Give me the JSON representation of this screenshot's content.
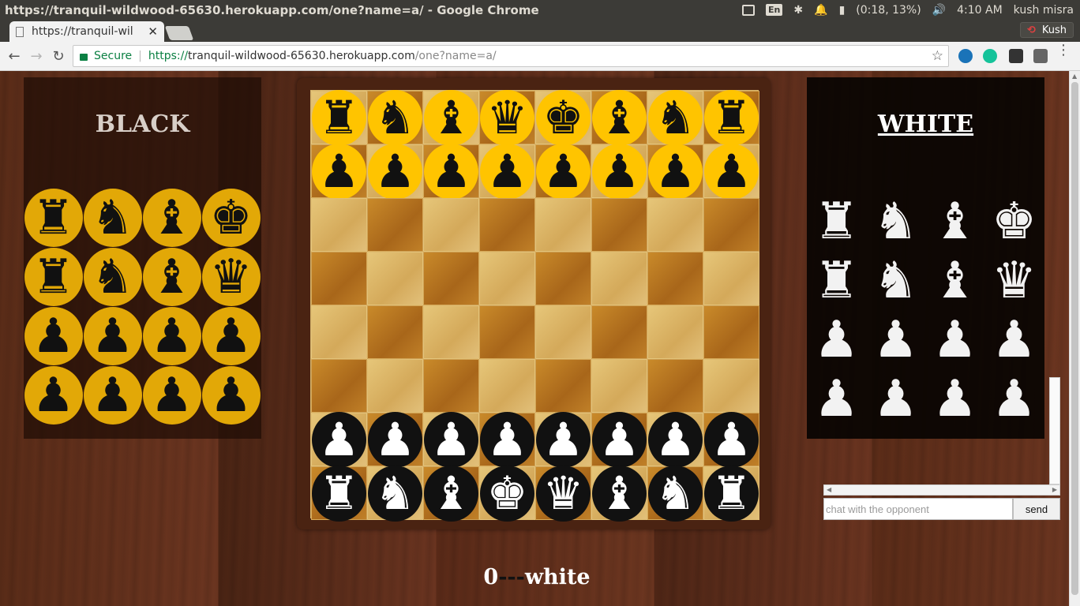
{
  "window": {
    "title": "https://tranquil-wildwood-65630.herokuapp.com/one?name=a/ - Google Chrome"
  },
  "tray": {
    "language": "En",
    "battery": "(0:18, 13%)",
    "time": "4:10 AM",
    "user": "kush misra"
  },
  "tab": {
    "label": "https://tranquil-wil",
    "close": "✕"
  },
  "profile": {
    "name": "Kush"
  },
  "address_bar": {
    "secure_label": "Secure",
    "scheme": "https://",
    "host": "tranquil-wildwood-65630.herokuapp.com",
    "path": "/one?name=a/"
  },
  "black_panel": {
    "title": "BLACK",
    "captured": [
      "♜",
      "♞",
      "♝",
      "♚",
      "♜",
      "♞",
      "♝",
      "♛",
      "♟",
      "♟",
      "♟",
      "♟",
      "♟",
      "♟",
      "♟",
      "♟"
    ]
  },
  "white_panel": {
    "title": "WHITE",
    "captured": [
      "♜",
      "♞",
      "♝",
      "♚",
      "♜",
      "♞",
      "♝",
      "♛",
      "♟",
      "♟",
      "♟",
      "♟",
      "♟",
      "♟",
      "♟",
      "♟"
    ]
  },
  "board": {
    "rows": [
      [
        "♜",
        "♞",
        "♝",
        "♛",
        "♚",
        "♝",
        "♞",
        "♜"
      ],
      [
        "♟",
        "♟",
        "♟",
        "♟",
        "♟",
        "♟",
        "♟",
        "♟"
      ],
      [
        "",
        "",
        "",
        "",
        "",
        "",
        "",
        ""
      ],
      [
        "",
        "",
        "",
        "",
        "",
        "",
        "",
        ""
      ],
      [
        "",
        "",
        "",
        "",
        "",
        "",
        "",
        ""
      ],
      [
        "",
        "",
        "",
        "",
        "",
        "",
        "",
        ""
      ],
      [
        "♟",
        "♟",
        "♟",
        "♟",
        "♟",
        "♟",
        "♟",
        "♟"
      ],
      [
        "♜",
        "♞",
        "♝",
        "♚",
        "♛",
        "♝",
        "♞",
        "♜"
      ]
    ],
    "row_sides": [
      "black",
      "black",
      "",
      "",
      "",
      "",
      "white",
      "white"
    ]
  },
  "score": {
    "count": "0",
    "dashes": "---",
    "turn": "white"
  },
  "chat": {
    "placeholder": "chat with the opponent",
    "send_label": "send"
  },
  "colors": {
    "black_piece_disc": "#ffc400",
    "white_piece_disc": "#111111",
    "secure_green": "#0b8043"
  }
}
